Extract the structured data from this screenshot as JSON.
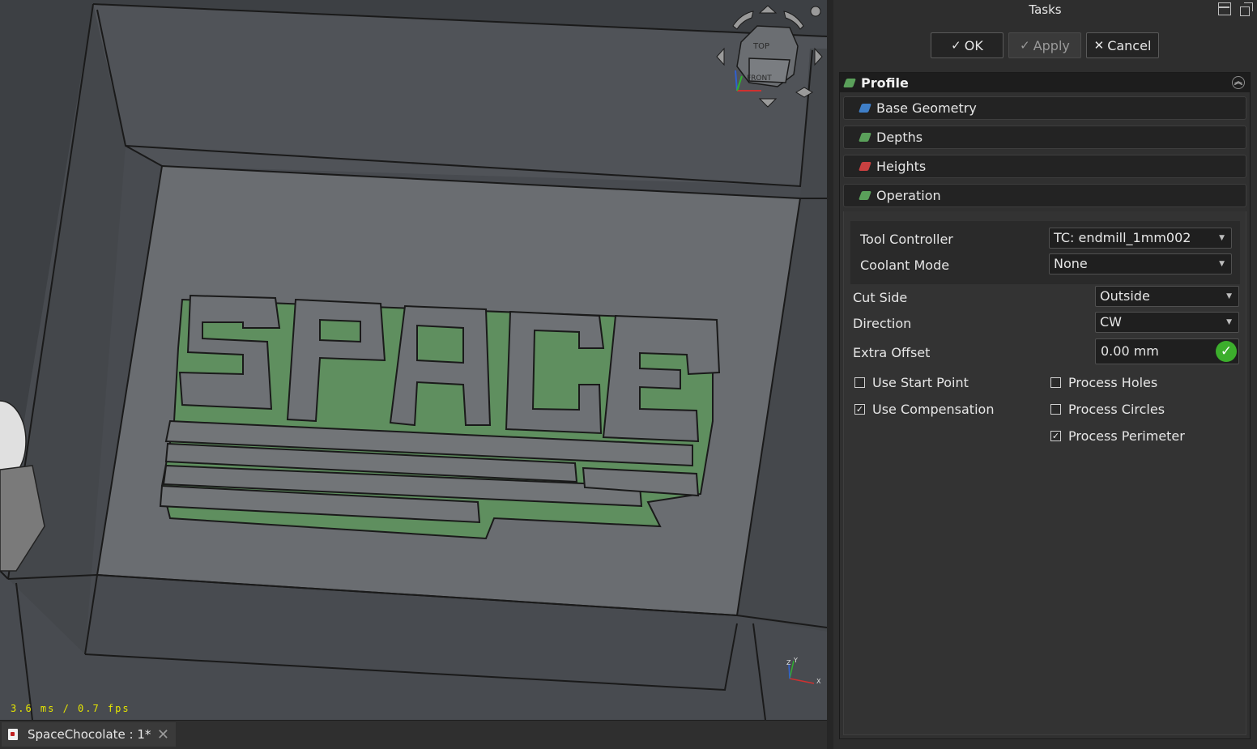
{
  "viewport": {
    "fps_text": "3.6 ms / 0.7 fps",
    "navcube_top_label": "TOP",
    "navcube_front_label": "FRONT",
    "axis_labels": {
      "x": "X",
      "y": "Y",
      "z": "Z"
    }
  },
  "document_tab": {
    "label": "SpaceChocolate : 1*",
    "close_glyph": "✕"
  },
  "task_panel": {
    "title": "Tasks",
    "buttons": {
      "ok": "OK",
      "apply": "Apply",
      "cancel": "Cancel",
      "check_glyph": "✓",
      "cross_glyph": "✕"
    },
    "profile_title": "Profile",
    "sections": [
      "Base Geometry",
      "Depths",
      "Heights",
      "Operation"
    ],
    "section_icon_colors": [
      "#3f7fc8",
      "#5aa05a",
      "#c84040",
      "#5aa05a"
    ],
    "operation": {
      "tool_controller_label": "Tool Controller",
      "tool_controller_value": "TC: endmill_1mm002",
      "coolant_mode_label": "Coolant Mode",
      "coolant_mode_value": "None",
      "cut_side_label": "Cut Side",
      "cut_side_value": "Outside",
      "direction_label": "Direction",
      "direction_value": "CW",
      "extra_offset_label": "Extra Offset",
      "extra_offset_value": "0.00 mm",
      "checkboxes": {
        "use_start_point": {
          "label": "Use Start Point",
          "checked": false
        },
        "use_compensation": {
          "label": "Use Compensation",
          "checked": true
        },
        "process_holes": {
          "label": "Process Holes",
          "checked": false
        },
        "process_circles": {
          "label": "Process Circles",
          "checked": false
        },
        "process_perimeter": {
          "label": "Process Perimeter",
          "checked": true
        }
      }
    }
  },
  "colors": {
    "accent_green": "#3cae2c",
    "part_green": "#5f8f5f",
    "viewport_bg": "#3d4044"
  }
}
